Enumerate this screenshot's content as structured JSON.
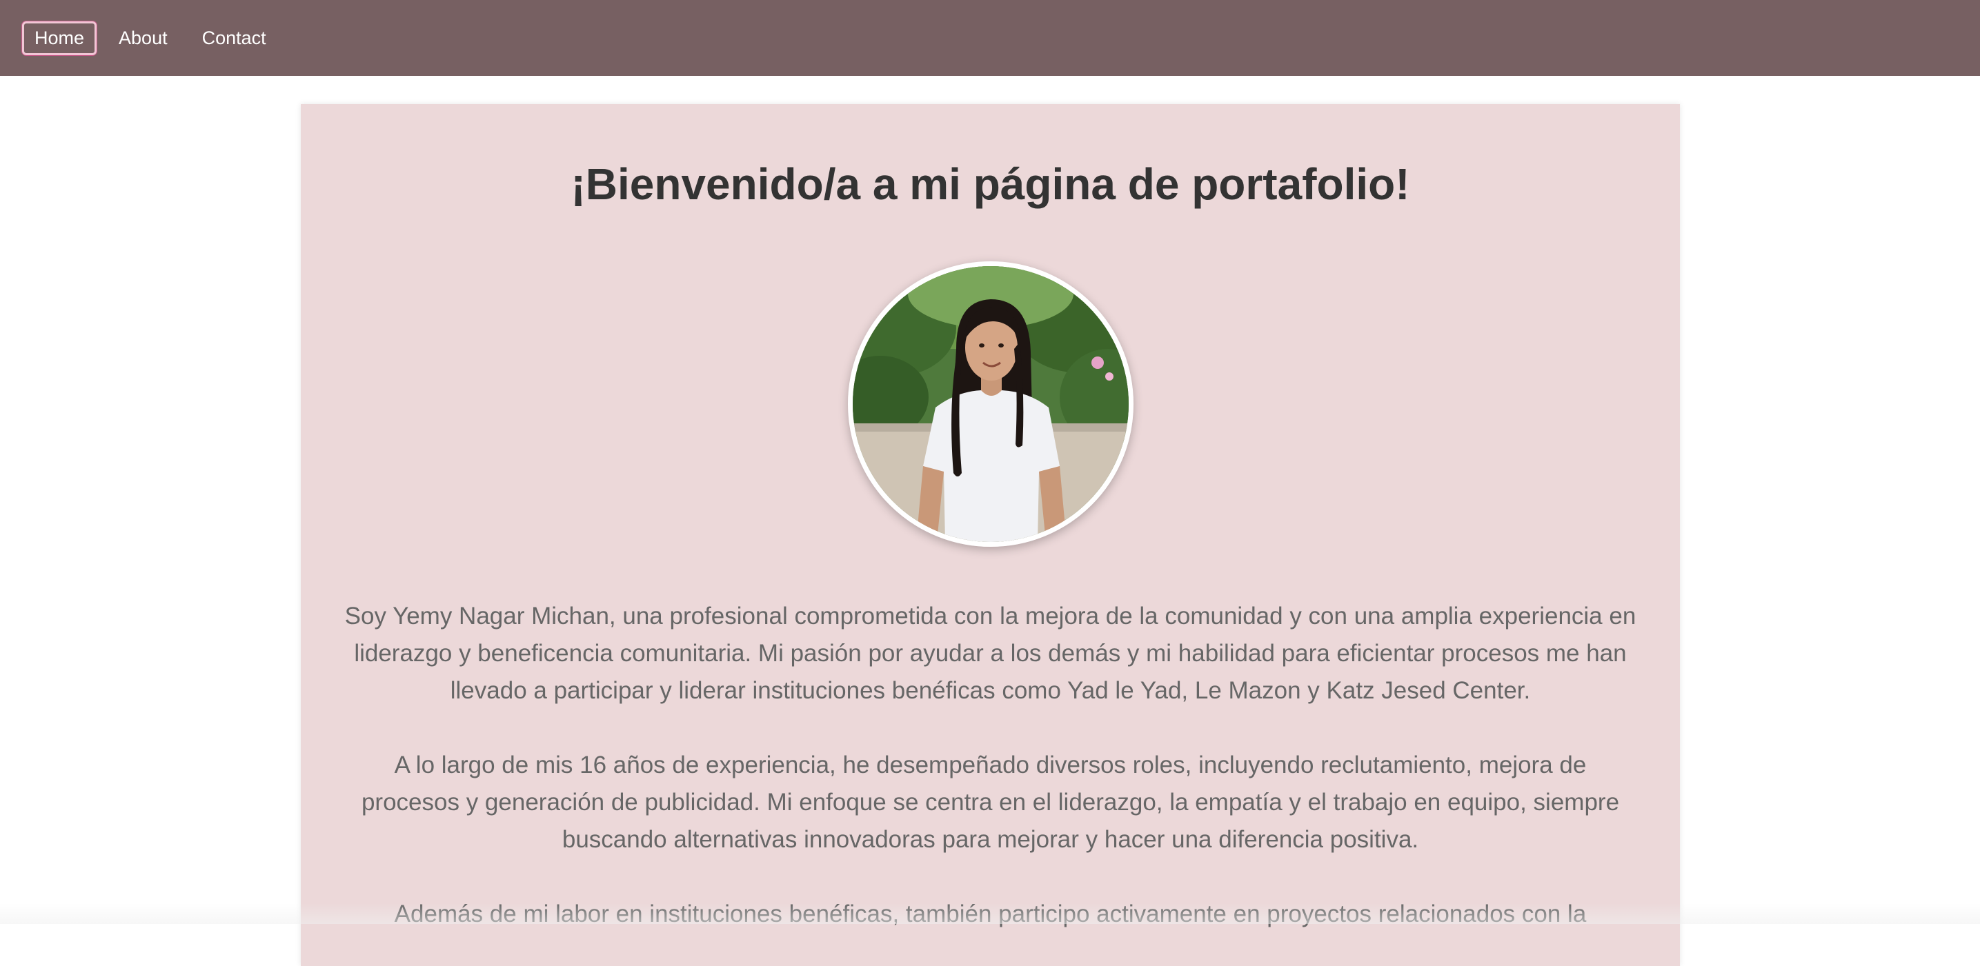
{
  "nav": {
    "items": [
      {
        "label": "Home",
        "active": true
      },
      {
        "label": "About",
        "active": false
      },
      {
        "label": "Contact",
        "active": false
      }
    ]
  },
  "main": {
    "title": "¡Bienvenido/a a mi página de portafolio!",
    "avatar_icon": "profile-photo",
    "paragraphs": [
      "Soy Yemy Nagar Michan, una profesional comprometida con la mejora de la comunidad y con una amplia experiencia en liderazgo y beneficencia comunitaria. Mi pasión por ayudar a los demás y mi habilidad para eficientar procesos me han llevado a participar y liderar instituciones benéficas como Yad le Yad, Le Mazon y Katz Jesed Center.",
      "A lo largo de mis 16 años de experiencia, he desempeñado diversos roles, incluyendo reclutamiento, mejora de procesos y generación de publicidad. Mi enfoque se centra en el liderazgo, la empatía y el trabajo en equipo, siempre buscando alternativas innovadoras para mejorar y hacer una diferencia positiva.",
      "Además de mi labor en instituciones benéficas, también participo activamente en proyectos relacionados con la"
    ]
  },
  "colors": {
    "navbar": "#776062",
    "card": "#ecd8d9",
    "title": "#333333",
    "body_text": "#666666",
    "active_outline": "#f2c6d6"
  }
}
